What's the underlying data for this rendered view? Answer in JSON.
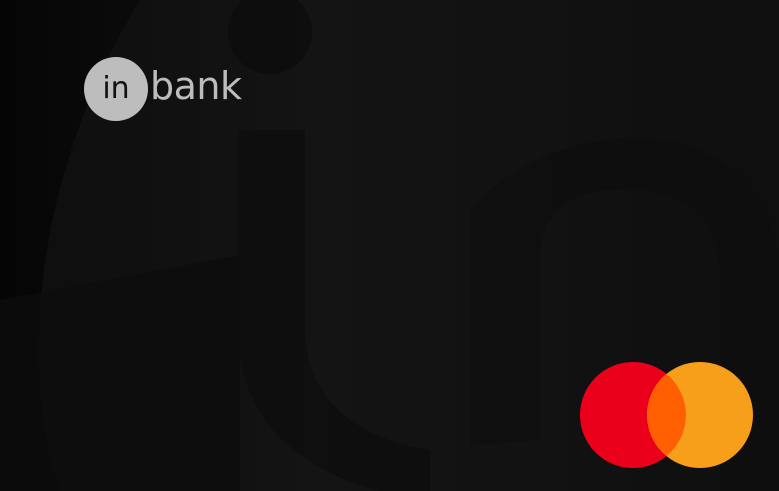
{
  "card": {
    "issuer_logo_mark": "in",
    "issuer_logo_word": "bank",
    "network_logo": "mastercard-logo"
  },
  "colors": {
    "background": "#0a0a0a",
    "logo": "#bdbdbd",
    "mastercard_red": "#eb001b",
    "mastercard_orange": "#f79e1b",
    "mastercard_overlap": "#ff5f00"
  }
}
